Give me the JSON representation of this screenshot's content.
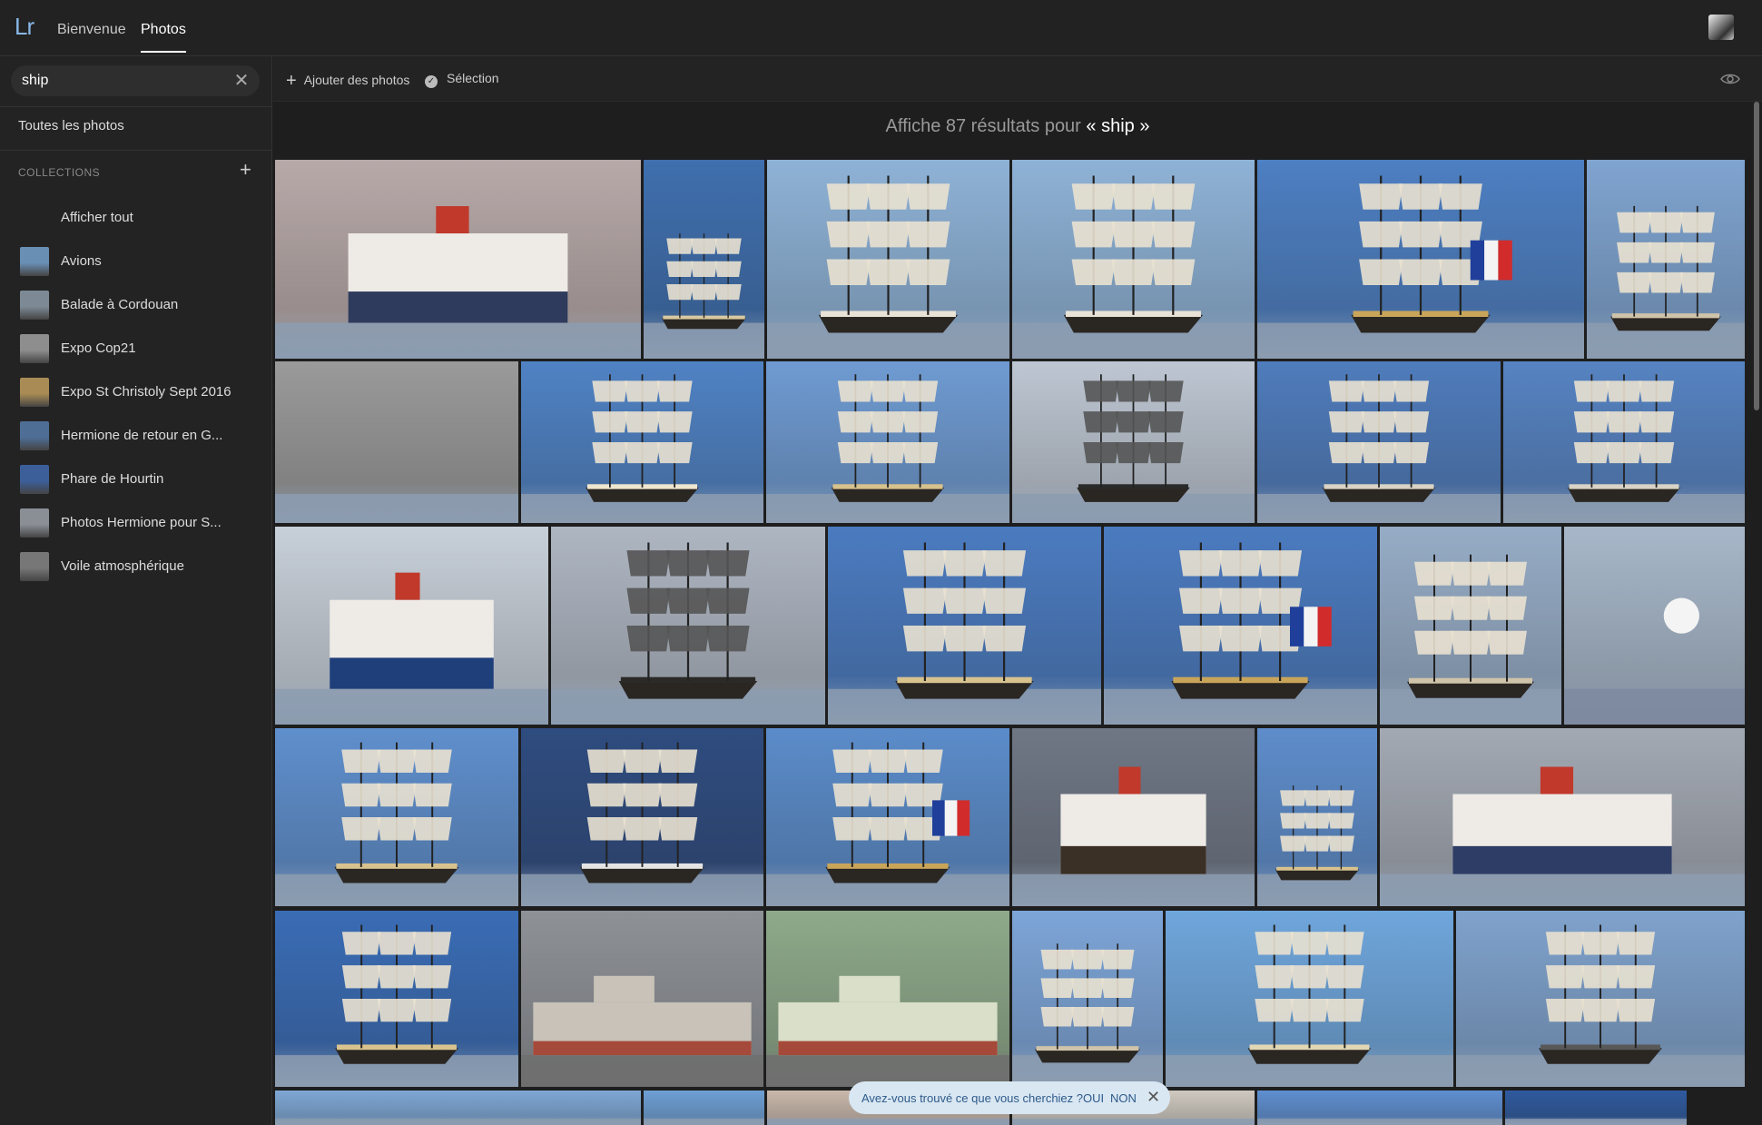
{
  "app": {
    "logo": "Lr"
  },
  "nav": {
    "tabs": [
      "Bienvenue",
      "Photos"
    ],
    "active": "Photos"
  },
  "search": {
    "value": "ship"
  },
  "sidebar": {
    "all_photos": "Toutes les photos",
    "collections_header": "COLLECTIONS",
    "collections": [
      {
        "label": "Afficher tout",
        "thumb_color": "#555555"
      },
      {
        "label": "Avions",
        "thumb_color": "#6a8fb5"
      },
      {
        "label": "Balade à Cordouan",
        "thumb_color": "#7d8a95"
      },
      {
        "label": "Expo Cop21",
        "thumb_color": "#8e8e8e"
      },
      {
        "label": "Expo St Christoly Sept 2016",
        "thumb_color": "#a98b55"
      },
      {
        "label": "Hermione de retour en G...",
        "thumb_color": "#4e6e96"
      },
      {
        "label": "Phare de Hourtin",
        "thumb_color": "#3c5f9a"
      },
      {
        "label": "Photos Hermione pour S...",
        "thumb_color": "#8a8f96"
      },
      {
        "label": "Voile atmosphérique",
        "thumb_color": "#777777"
      }
    ]
  },
  "toolbar": {
    "add_photos": "Ajouter des photos",
    "selection": "Sélection"
  },
  "results": {
    "prefix": "Affiche 87 résultats pour ",
    "query": "« ship »"
  },
  "photos": [
    {
      "subject": "ferry",
      "sky": "#b7a9a8",
      "accent": "#2f3b5c"
    },
    {
      "subject": "tall-ship",
      "sky": "#3f6fae",
      "accent": "#d9c9a0"
    },
    {
      "subject": "tall-ship-sails",
      "sky": "#8eb2d6",
      "accent": "#e8e2d6"
    },
    {
      "subject": "tall-ship-sails",
      "sky": "#8eb2d6",
      "accent": "#e8e2d6"
    },
    {
      "subject": "tall-ship-flag",
      "sky": "#4d7fc2",
      "accent": "#c9a55a"
    },
    {
      "subject": "masts",
      "sky": "#7fa4d0",
      "accent": "#cfc3a9"
    },
    {
      "subject": "bw-ship",
      "sky": "#9a9a9a",
      "accent": "#222222"
    },
    {
      "subject": "tall-ship-sails",
      "sky": "#4f82c4",
      "accent": "#efe6cf"
    },
    {
      "subject": "tall-ship",
      "sky": "#6f9bd2",
      "accent": "#d7c18c"
    },
    {
      "subject": "tall-ship-cloudy",
      "sky": "#bdc6d2",
      "accent": "#2a2a2a"
    },
    {
      "subject": "harbour",
      "sky": "#4f7cbc",
      "accent": "#d8d3c5"
    },
    {
      "subject": "harbour",
      "sky": "#5683c2",
      "accent": "#d8d3c5"
    },
    {
      "subject": "ferry-white",
      "sky": "#c7cfd8",
      "accent": "#1e3f7a"
    },
    {
      "subject": "tall-ship-cloudy",
      "sky": "#aeb6c2",
      "accent": "#2b2a27"
    },
    {
      "subject": "tall-ship",
      "sky": "#4b7bc0",
      "accent": "#d8c38e"
    },
    {
      "subject": "tall-ship-flag",
      "sky": "#4b7bc0",
      "accent": "#c9a55a"
    },
    {
      "subject": "masts",
      "sky": "#96acc6",
      "accent": "#cfc3a9"
    },
    {
      "subject": "sun-sky",
      "sky": "#a7b7c9",
      "accent": "#333333"
    },
    {
      "subject": "tall-ship",
      "sky": "#5f8fcd",
      "accent": "#d8c38e"
    },
    {
      "subject": "tall-ship-stormy",
      "sky": "#2f4c80",
      "accent": "#e4e4e4"
    },
    {
      "subject": "tall-ship-flag",
      "sky": "#5b8cca",
      "accent": "#c9a55a"
    },
    {
      "subject": "ferry-dusk",
      "sky": "#6f7785",
      "accent": "#3a3026"
    },
    {
      "subject": "tall-ship",
      "sky": "#5e8dcb",
      "accent": "#d8c38e"
    },
    {
      "subject": "ferry-grey",
      "sky": "#a3a9b3",
      "accent": "#2d3d66"
    },
    {
      "subject": "tall-ship",
      "sky": "#3a6cb5",
      "accent": "#d8c38e"
    },
    {
      "subject": "dredger",
      "sky": "#8e9196",
      "accent": "#c8c2b9"
    },
    {
      "subject": "dredger-green",
      "sky": "#8ea98a",
      "accent": "#d9dfc8"
    },
    {
      "subject": "masts",
      "sky": "#7da5d8",
      "accent": "#cfc3a9"
    },
    {
      "subject": "two-ships",
      "sky": "#6fa6dc",
      "accent": "#e2d7b5"
    },
    {
      "subject": "bridge-ship",
      "sky": "#7fa2cc",
      "accent": "#585858"
    },
    {
      "subject": "partial",
      "sky": "#7ea7d4",
      "accent": "#cccccc"
    },
    {
      "subject": "partial",
      "sky": "#6e9fd4",
      "accent": "#cccccc"
    },
    {
      "subject": "partial",
      "sky": "#c9b8ac",
      "accent": "#cccccc"
    },
    {
      "subject": "partial",
      "sky": "#cfc9c0",
      "accent": "#cccccc"
    },
    {
      "subject": "partial",
      "sky": "#5f8fd0",
      "accent": "#cccccc"
    },
    {
      "subject": "partial",
      "sky": "#2f5a9e",
      "accent": "#cccccc"
    }
  ],
  "feedback": {
    "question": "Avez-vous trouvé ce que vous cherchiez ?",
    "yes": "OUI",
    "no": "NON"
  }
}
